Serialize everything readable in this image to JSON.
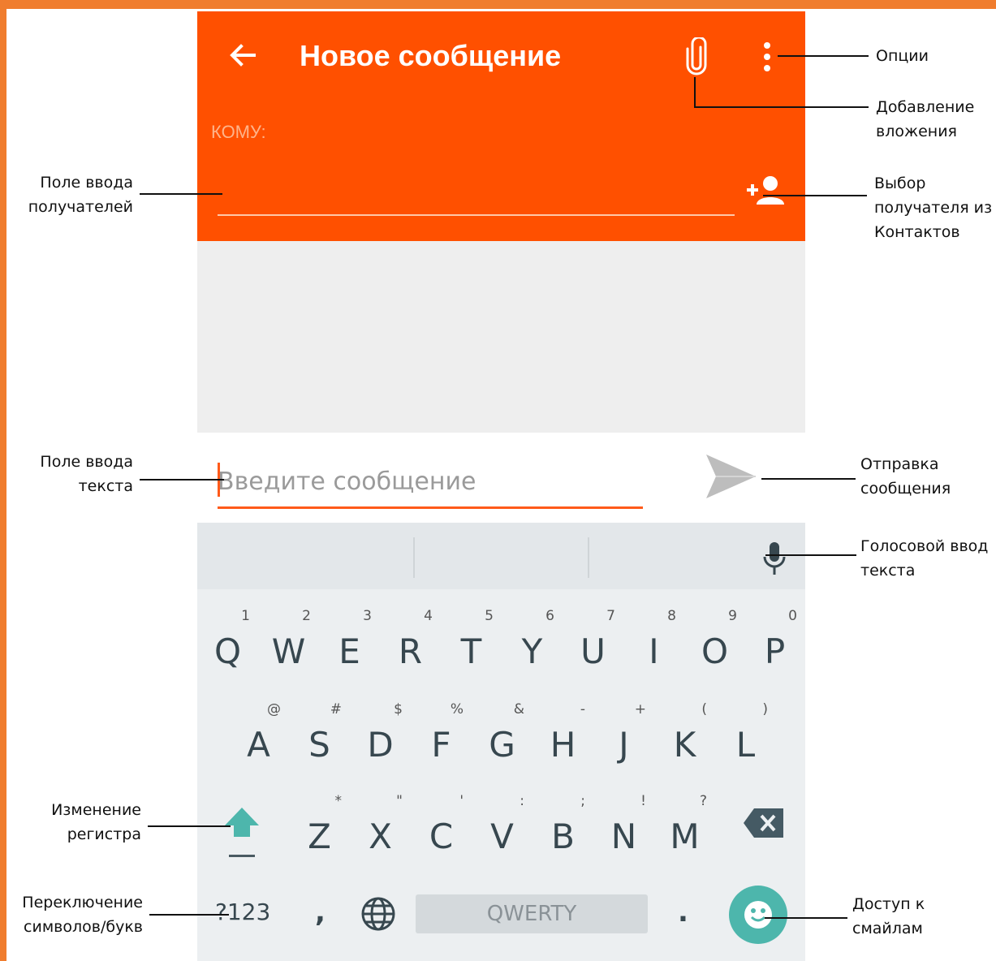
{
  "frame": {
    "accent": "#f07d2e"
  },
  "appbar": {
    "title": "Новое сообщение",
    "to_label": "КОМУ:",
    "color": "#ff5000"
  },
  "icons": {
    "back": "arrow-left-icon",
    "attach": "paperclip-icon",
    "menu": "more-vert-icon",
    "add_contact": "person-add-icon",
    "send": "send-icon",
    "mic": "mic-icon",
    "shift": "shift-arrow-icon",
    "backspace": "backspace-icon",
    "globe": "globe-icon",
    "emoji": "emoji-icon"
  },
  "compose": {
    "placeholder": "Введите сообщение"
  },
  "keyboard": {
    "row1": [
      {
        "key": "Q",
        "sub": "1"
      },
      {
        "key": "W",
        "sub": "2"
      },
      {
        "key": "E",
        "sub": "3"
      },
      {
        "key": "R",
        "sub": "4"
      },
      {
        "key": "T",
        "sub": "5"
      },
      {
        "key": "Y",
        "sub": "6"
      },
      {
        "key": "U",
        "sub": "7"
      },
      {
        "key": "I",
        "sub": "8"
      },
      {
        "key": "O",
        "sub": "9"
      },
      {
        "key": "P",
        "sub": "0"
      }
    ],
    "row2": [
      {
        "key": "A",
        "sub": "@"
      },
      {
        "key": "S",
        "sub": "#"
      },
      {
        "key": "D",
        "sub": "$"
      },
      {
        "key": "F",
        "sub": "%"
      },
      {
        "key": "G",
        "sub": "&"
      },
      {
        "key": "H",
        "sub": "-"
      },
      {
        "key": "J",
        "sub": "+"
      },
      {
        "key": "K",
        "sub": "("
      },
      {
        "key": "L",
        "sub": ")"
      }
    ],
    "row3": [
      {
        "key": "Z",
        "sub": "*"
      },
      {
        "key": "X",
        "sub": "\""
      },
      {
        "key": "C",
        "sub": "'"
      },
      {
        "key": "V",
        "sub": ":"
      },
      {
        "key": "B",
        "sub": ";"
      },
      {
        "key": "N",
        "sub": "!"
      },
      {
        "key": "M",
        "sub": "?"
      }
    ],
    "symbols_key": "?123",
    "comma": ",",
    "space": "QWERTY",
    "period": ".",
    "emoji_color": "#4db6ac",
    "shift_color": "#4db6ac"
  },
  "annotations": {
    "options": "Опции",
    "attach_l1": "Добавление",
    "attach_l2": "вложения",
    "recipients_l1": "Поле ввода",
    "recipients_l2": "получателей",
    "contacts_l1": "Выбор",
    "contacts_l2": "получателя из",
    "contacts_l3": "Контактов",
    "text_l1": "Поле ввода",
    "text_l2": "текста",
    "send_l1": "Отправка",
    "send_l2": "сообщения",
    "voice_l1": "Голосовой ввод",
    "voice_l2": "текста",
    "case_l1": "Изменение",
    "case_l2": "регистра",
    "switch_l1": "Переключение",
    "switch_l2": "символов/букв",
    "smiles_l1": "Доступ к",
    "smiles_l2": "смайлам"
  }
}
